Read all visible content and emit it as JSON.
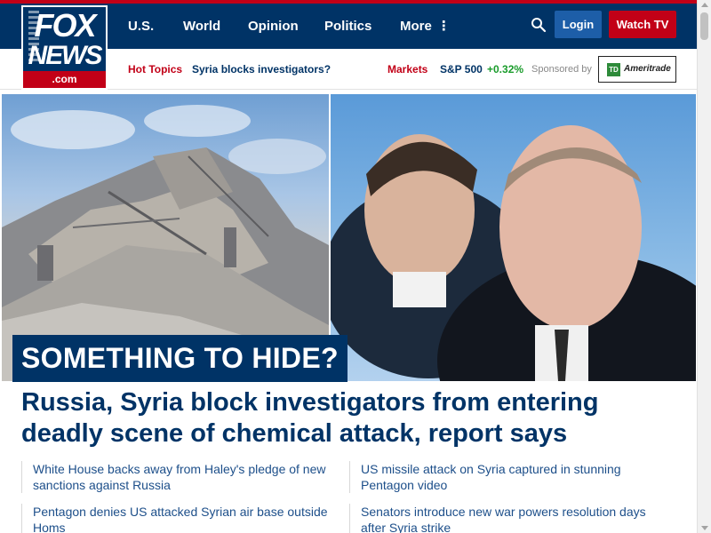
{
  "logo": {
    "line1": "FOX",
    "line2": "NEWS",
    "line3": ".com"
  },
  "nav": {
    "items": [
      {
        "label": "U.S."
      },
      {
        "label": "World"
      },
      {
        "label": "Opinion"
      },
      {
        "label": "Politics"
      },
      {
        "label": "More"
      }
    ],
    "more_icon": "⋮",
    "search_icon": "search-icon",
    "login_label": "Login",
    "watch_label": "Watch TV"
  },
  "subbar": {
    "hot_topics_label": "Hot Topics",
    "hot_topic_link": "Syria blocks investigators?",
    "markets_label": "Markets",
    "index_name": "S&P 500",
    "index_change": "+0.32%",
    "sponsored_label": "Sponsored by",
    "sponsor_badge": "TD",
    "sponsor_name": "Ameritrade"
  },
  "hero": {
    "kicker": "SOMETHING TO HIDE?",
    "headline": "Russia, Syria block investigators from entering deadly scene of chemical attack, report says"
  },
  "related": [
    "White House backs away from Haley's pledge of new sanctions against Russia",
    "US missile attack on Syria captured in stunning Pentagon video",
    "Pentagon denies US attacked Syrian air base outside Homs",
    "Senators introduce new war powers resolution days after Syria strike"
  ],
  "colors": {
    "brand_navy": "#003366",
    "brand_red": "#c20017",
    "login_blue": "#1d5ea8",
    "market_green": "#1a9c2b"
  }
}
